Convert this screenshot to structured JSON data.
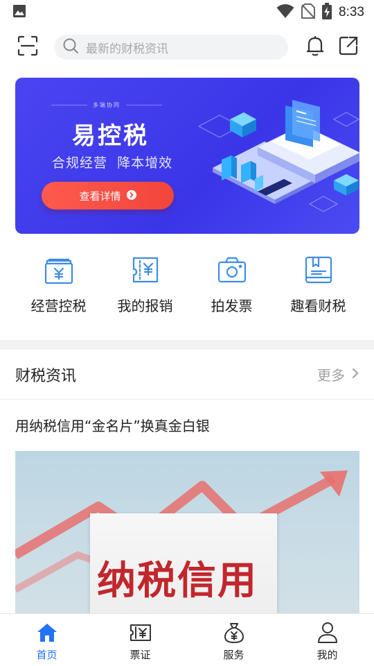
{
  "status_bar": {
    "time": "8:33",
    "icons": [
      "image-notification-icon",
      "wifi-icon",
      "no-sim-icon",
      "battery-charging-icon"
    ]
  },
  "top_bar": {
    "scan_icon": "scan-icon",
    "search_placeholder": "最新的财税资讯",
    "bell_icon": "bell-icon",
    "share_icon": "share-icon"
  },
  "banner": {
    "tagline": "多端协同",
    "title": "易控税",
    "subtitle": "合规经营  降本增效",
    "cta_label": "查看详情"
  },
  "quick_menu": [
    {
      "label": "经营控税",
      "icon": "tax-control-icon"
    },
    {
      "label": "我的报销",
      "icon": "reimbursement-icon"
    },
    {
      "label": "拍发票",
      "icon": "camera-icon"
    },
    {
      "label": "趣看财税",
      "icon": "book-icon"
    }
  ],
  "news": {
    "section_title": "财税资讯",
    "more_label": "更多",
    "headline": "用纳税信用“金名片”换真金白银",
    "image_text": "纳税信用"
  },
  "bottom_nav": [
    {
      "label": "首页",
      "icon": "home-icon",
      "active": true
    },
    {
      "label": "票证",
      "icon": "ticket-icon",
      "active": false
    },
    {
      "label": "服务",
      "icon": "money-bag-icon",
      "active": false
    },
    {
      "label": "我的",
      "icon": "user-icon",
      "active": false
    }
  ],
  "colors": {
    "accent": "#2273f5",
    "banner_bg": "#3f3bea",
    "cta": "#f2453c",
    "icon_blue": "#3d8ce6"
  }
}
